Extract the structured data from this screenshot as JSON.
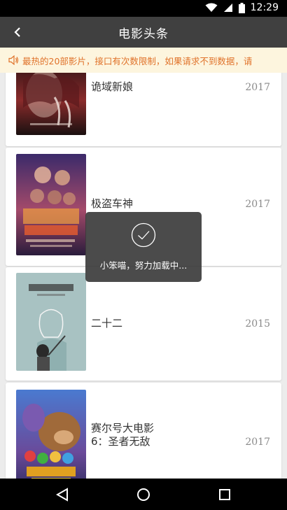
{
  "status_bar": {
    "time": "12:29",
    "icons": [
      "wifi-icon",
      "signal-icon",
      "battery-icon"
    ]
  },
  "app_bar": {
    "title": "电影头条",
    "back_icon": "back-arrow-icon"
  },
  "notice": {
    "icon": "speaker-icon",
    "text": "最热的20部影片，接口有次数限制，如果请求不到数据，请"
  },
  "movies": [
    {
      "name": "诡域新娘",
      "year": "2017"
    },
    {
      "name": "极盗车神",
      "year": "2017"
    },
    {
      "name": "二十二",
      "year": "2015"
    },
    {
      "name": "赛尔号大电影6：圣者无敌",
      "year": "2017"
    }
  ],
  "toast": {
    "icon": "check-circle-icon",
    "text": "小笨喵，努力加载中..."
  },
  "nav_bar": {
    "back": "nav-back-icon",
    "home": "nav-home-icon",
    "recents": "nav-recents-icon"
  },
  "colors": {
    "app_bar": "#404040",
    "notice_bg": "#fdf5de",
    "notice_text": "#e0722a"
  }
}
